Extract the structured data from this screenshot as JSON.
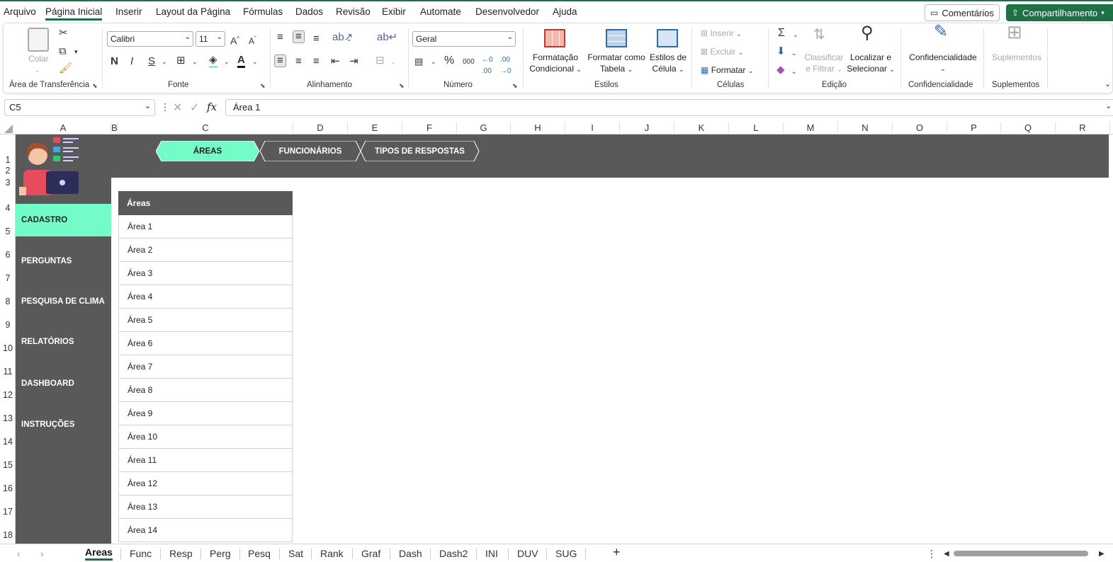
{
  "menu": {
    "items": [
      "Arquivo",
      "Página Inicial",
      "Inserir",
      "Layout da Página",
      "Fórmulas",
      "Dados",
      "Revisão",
      "Exibir",
      "Automate",
      "Desenvolvedor",
      "Ajuda"
    ],
    "active": "Página Inicial",
    "comments_label": "Comentários",
    "share_label": "Compartilhamento"
  },
  "ribbon": {
    "clipboard": {
      "paste_label": "Colar",
      "group_label": "Área de Transferência"
    },
    "font": {
      "font_name": "Calibri",
      "font_size": "11",
      "group_label": "Fonte"
    },
    "alignment": {
      "group_label": "Alinhamento"
    },
    "number": {
      "format": "Geral",
      "group_label": "Número"
    },
    "styles": {
      "conditional_line1": "Formatação",
      "conditional_line2": "Condicional",
      "table_line1": "Formatar como",
      "table_line2": "Tabela",
      "cell_line1": "Estilos de",
      "cell_line2": "Célula",
      "group_label": "Estilos"
    },
    "cells": {
      "insert_label": "Inserir",
      "delete_label": "Excluir",
      "format_label": "Formatar",
      "group_label": "Células"
    },
    "editing": {
      "sort_line1": "Classificar",
      "sort_line2": "e Filtrar",
      "find_line1": "Localizar e",
      "find_line2": "Selecionar",
      "group_label": "Edição"
    },
    "sensitivity": {
      "label": "Confidencialidade",
      "group_label": "Confidencialidade"
    },
    "addins": {
      "label": "Suplementos",
      "group_label": "Suplementos"
    }
  },
  "formula_bar": {
    "name_box": "C5",
    "fx": "fx",
    "value": "Área 1"
  },
  "columns": [
    "A",
    "B",
    "C",
    "D",
    "E",
    "F",
    "G",
    "H",
    "I",
    "J",
    "K",
    "L",
    "M",
    "N",
    "O",
    "P",
    "Q",
    "R"
  ],
  "rows": [
    "1",
    "2",
    "3",
    "4",
    "5",
    "6",
    "7",
    "8",
    "9",
    "10",
    "11",
    "12",
    "13",
    "14",
    "15",
    "16",
    "17",
    "18"
  ],
  "top_tabs": [
    "ÁREAS",
    "FUNCIONÁRIOS",
    "TIPOS DE RESPOSTAS"
  ],
  "top_tab_active": "ÁREAS",
  "sidebar": [
    "CADASTRO",
    "PERGUNTAS",
    "PESQUISA DE CLIMA",
    "RELATÓRIOS",
    "DASHBOARD",
    "INSTRUÇÕES"
  ],
  "sidebar_active": "CADASTRO",
  "table": {
    "header": "Áreas",
    "rows": [
      "Área 1",
      "Área 2",
      "Área 3",
      "Área 4",
      "Área 5",
      "Área 6",
      "Área 7",
      "Área 8",
      "Área 9",
      "Área 10",
      "Área 11",
      "Área 12",
      "Área 13",
      "Área 14"
    ]
  },
  "sheet_tabs": [
    "Areas",
    "Func",
    "Resp",
    "Perg",
    "Pesq",
    "Sat",
    "Rank",
    "Graf",
    "Dash",
    "Dash2",
    "INI",
    "DUV",
    "SUG"
  ],
  "sheet_active": "Areas",
  "colors": {
    "accent": "#73fcc8",
    "dark": "#595959",
    "excel_green": "#1e7145"
  }
}
